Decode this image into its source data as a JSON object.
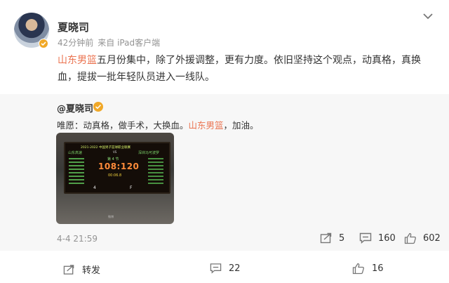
{
  "post": {
    "author": "夏晓司",
    "time_ago": "42分钟前",
    "source": "来自 iPad客户端",
    "text_link": "山东男篮",
    "text_rest": "五月份集中，除了外援调整，更有力度。依旧坚持这个观点，动真格，真换血，提拔一批年轻队员进入一线队。"
  },
  "repost": {
    "author": "@夏晓司",
    "text_before_link": "唯愿：动真格，做手术，大换血。",
    "text_link": "山东男篮",
    "text_after_link": "，加油。",
    "time": "4-4 21:59",
    "reposts": "5",
    "comments": "160",
    "likes": "602",
    "image": {
      "title": "2021-2022 中国男子篮球职业联赛",
      "home_team": "山东高速",
      "vs": "VS",
      "away_team": "深圳马可波罗",
      "quarter": "第 4 节",
      "score": "108:120",
      "clock": "00:06.8",
      "home_fouls": "4",
      "away_fouls": "F",
      "watermark": "微博"
    }
  },
  "footer": {
    "forward_label": "转发",
    "comment_count": "22",
    "like_count": "16"
  },
  "colors": {
    "link": "#eb7350",
    "gold": "#f0a828",
    "meta": "#939393"
  }
}
